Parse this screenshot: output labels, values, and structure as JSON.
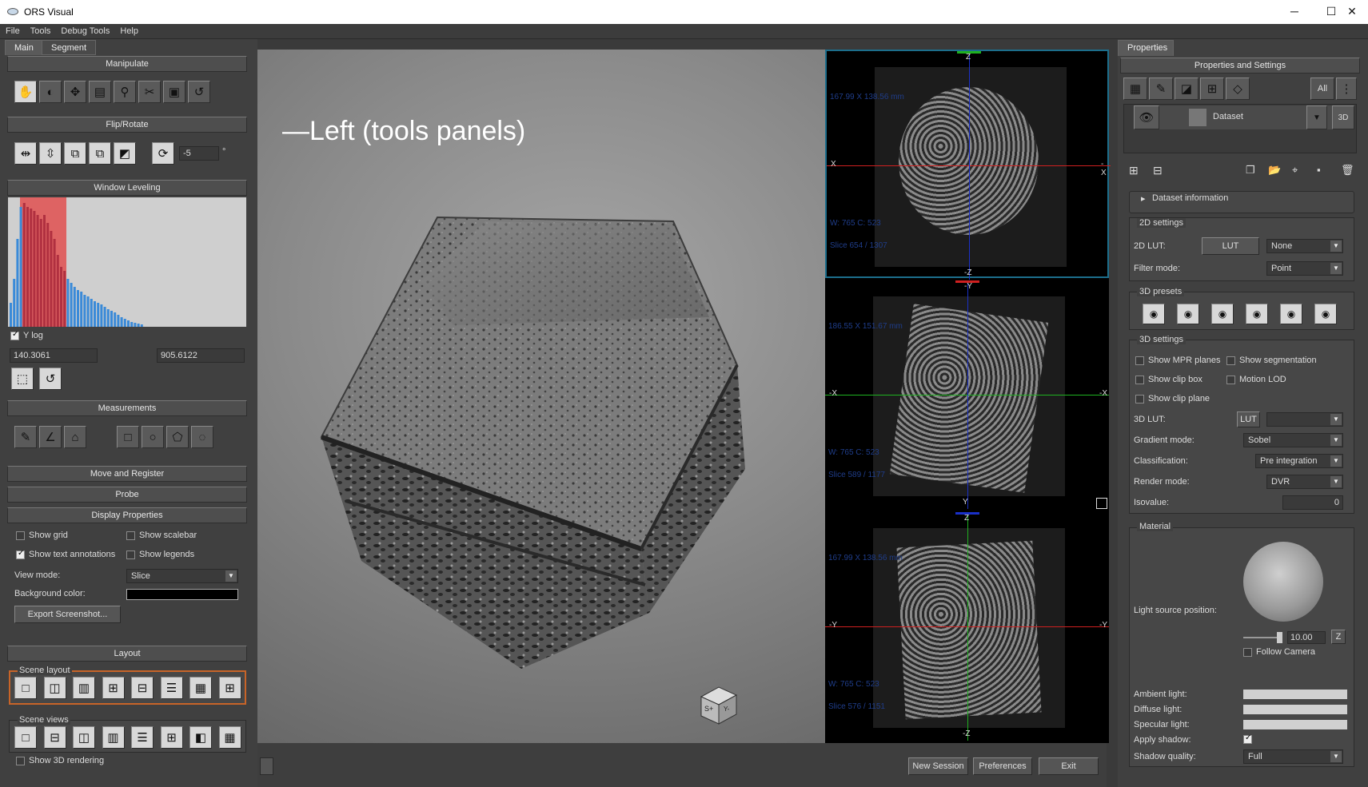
{
  "window": {
    "title": "ORS Visual",
    "minimize": "─",
    "maximize": "☐",
    "close": "✕"
  },
  "menu": [
    "File",
    "Tools",
    "Debug Tools",
    "Help"
  ],
  "left": {
    "tabs": [
      "Main",
      "Segment"
    ],
    "sections": {
      "manipulate": "Manipulate",
      "flip": "Flip/Rotate",
      "window_leveling": "Window Leveling",
      "measurements": "Measurements",
      "move_register": "Move and Register",
      "probe": "Probe",
      "display": "Display Properties",
      "layout": "Layout"
    },
    "rotate_value": "-5",
    "degree": "°",
    "ylog": "Y log",
    "wl_min": "140.3061",
    "wl_max": "905.6122",
    "display": {
      "show_grid": "Show grid",
      "show_scalebar": "Show scalebar",
      "show_text_annotations": "Show text annotations",
      "show_legends": "Show legends",
      "view_mode_label": "View mode:",
      "view_mode_value": "Slice",
      "bg_color_label": "Background color:",
      "export": "Export Screenshot..."
    },
    "layout": {
      "scene_layout": "Scene layout",
      "scene_views": "Scene views",
      "show_3d": "Show 3D rendering"
    }
  },
  "annotation": "—Left (tools panels)",
  "mpr": [
    {
      "top_axis": "Z",
      "bottom_axis": "-Z",
      "left_axis": "X",
      "right_axis": "-X",
      "dims": "167.99 X 138.56 mm",
      "wl": "W: 765 C: 523",
      "slice": "Slice 654 / 1307"
    },
    {
      "top_axis": "-Y",
      "bottom_axis": "Y",
      "left_axis": "-X",
      "right_axis": "-X",
      "dims": "186.55 X 151.67 mm",
      "wl": "W: 765 C: 523",
      "slice": "Slice 589 / 1177"
    },
    {
      "top_axis": "Z",
      "bottom_axis": "-Z",
      "left_axis": "-Y",
      "right_axis": "-Y",
      "dims": "167.99 X 138.56 mm",
      "wl": "W: 765 C: 523",
      "slice": "Slice 576 / 1151"
    }
  ],
  "bottom": {
    "new_session": "New Session",
    "preferences": "Preferences",
    "exit": "Exit"
  },
  "right": {
    "tab": "Properties",
    "header": "Properties and Settings",
    "all": "All",
    "dataset": "Dataset",
    "badge3d": "3D",
    "dataset_info": "Dataset information",
    "settings2d": "2D settings",
    "lut2d_label": "2D LUT:",
    "lut_btn": "LUT",
    "lut2d_value": "None",
    "filter_label": "Filter mode:",
    "filter_value": "Point",
    "presets3d": "3D presets",
    "settings3d": "3D settings",
    "show_mpr": "Show MPR planes",
    "show_seg": "Show segmentation",
    "show_clipbox": "Show clip box",
    "motion_lod": "Motion LOD",
    "show_clipplane": "Show clip plane",
    "lut3d_label": "3D LUT:",
    "lut3d_btn": "LUT",
    "gradient_label": "Gradient mode:",
    "gradient_value": "Sobel",
    "class_label": "Classification:",
    "class_value": "Pre integration",
    "render_label": "Render mode:",
    "render_value": "DVR",
    "iso_label": "Isovalue:",
    "iso_value": "0",
    "material": "Material",
    "light_pos": "Light source position:",
    "light_value": "10.00",
    "z_btn": "Z",
    "follow_camera": "Follow Camera",
    "ambient": "Ambient light:",
    "diffuse": "Diffuse light:",
    "specular": "Specular light:",
    "shadow": "Apply shadow:",
    "shadow_quality": "Shadow quality:",
    "shadow_quality_value": "Full"
  }
}
